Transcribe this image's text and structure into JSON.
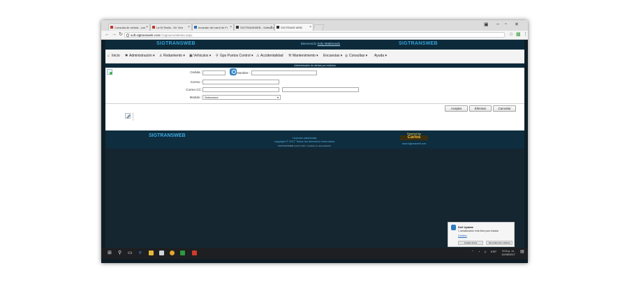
{
  "browser": {
    "tabs": [
      {
        "label": "Consulta de cédula - con"
      },
      {
        "label": "La W Radio - En Vivo"
      },
      {
        "label": "Incautan del carril de Fr"
      },
      {
        "label": "SIGTRANSWEB - Software"
      },
      {
        "label": "SIGTRANS WEB"
      }
    ],
    "url_host": "soft.sigtransweb.com",
    "url_path": "/AsignacionMetas.aspx"
  },
  "app": {
    "logo": "SIGTRANSWEB",
    "logo_right": "SIGTRANSWEB",
    "welcome_prefix": "Bienvenido",
    "welcome_user": "Sofy Maldonado"
  },
  "menu": [
    {
      "label": "Inicio",
      "icon": "home-icon",
      "glyph": "⌂"
    },
    {
      "label": "Administración ▾",
      "icon": "gear-icon",
      "glyph": "✱"
    },
    {
      "label": "Rodamiento ▾",
      "icon": "person-icon",
      "glyph": "♙"
    },
    {
      "label": "Vehiculos ▾",
      "icon": "bus-icon",
      "glyph": "▣"
    },
    {
      "label": "Gps Puntos Control ▾",
      "icon": "pin-icon",
      "glyph": "⚲"
    },
    {
      "label": "Accidentalidad",
      "icon": "accident-icon",
      "glyph": "⚠"
    },
    {
      "label": "Mantenimiento ▾",
      "icon": "wrench-icon",
      "glyph": "⚒"
    },
    {
      "label": "Encuestas ▾",
      "icon": "",
      "glyph": ""
    },
    {
      "label": "Consultas ▾",
      "icon": "search-icon",
      "glyph": "◎"
    },
    {
      "label": "Ayuda ▾",
      "icon": "",
      "glyph": ""
    }
  ],
  "subtitle": "Administración de alertas por módulos",
  "form": {
    "cedula_label": "Cedula :",
    "nombre_label": "Nombre :",
    "correo_label": "Correo :",
    "correo_cc_label": "Correo CC:",
    "modulo_label": "Modulo :",
    "modulo_selected": "Seleccione"
  },
  "buttons": {
    "aceptar": "Aceptar",
    "eliminar": "Eliminar",
    "cancelar": "Cancelar"
  },
  "footer": {
    "logo": "SIGTRANSWEB",
    "license_line1": "Licencia autorizada",
    "license_line2": "copyright © 2017 Todos los derechos reservados",
    "version": "SIGTRANSWEB versión 2017, módulos en demostración",
    "powered": "Powered by",
    "brand": "Carlos",
    "website": "www.sigtransweb.com"
  },
  "notification": {
    "title": "Dell Update",
    "message": "1 actualización está lista para instalar",
    "details_link": "Detalles",
    "install_button": "Instalar ahora",
    "remind_button": "Recordármelo mañana"
  },
  "taskbar": {
    "language": "ESP",
    "time": "9:04 p. m.",
    "date": "11/08/2017"
  },
  "colors": {
    "header_bg": "#0d2a3b",
    "accent_blue": "#36a3d8",
    "page_bg": "#152631"
  }
}
